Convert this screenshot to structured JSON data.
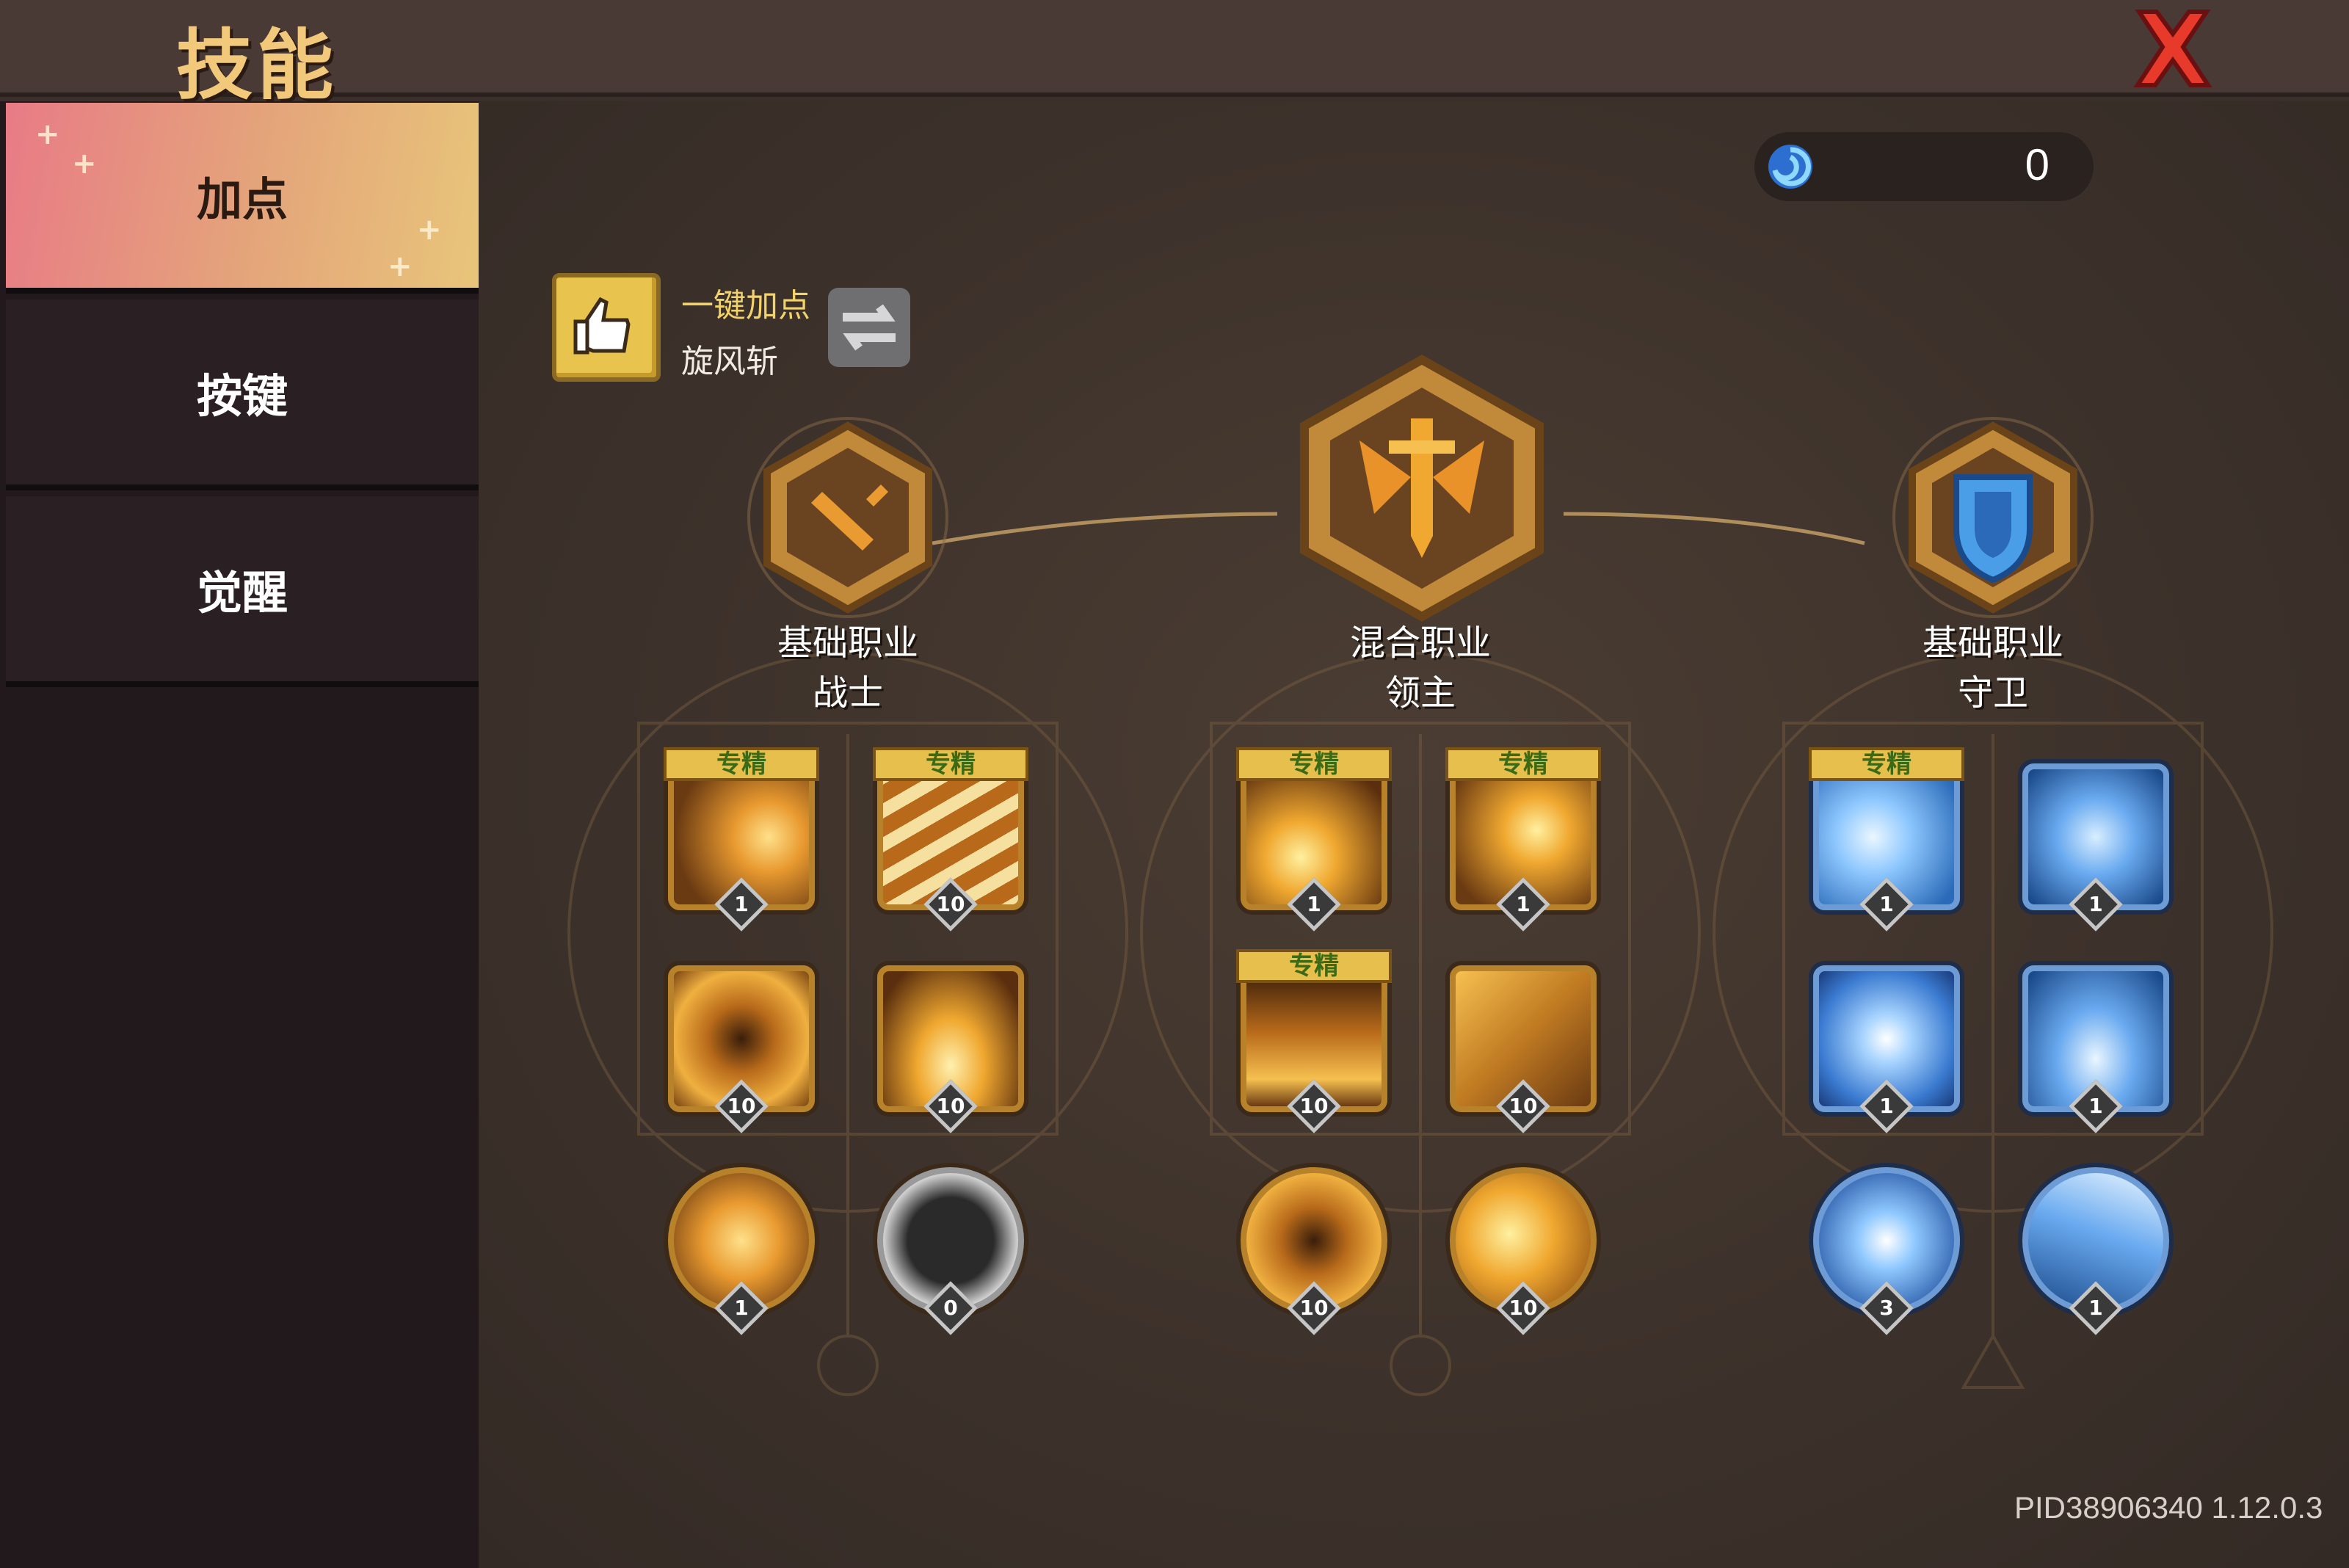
{
  "window": {
    "title": "技能"
  },
  "sidebar": {
    "tabs": [
      {
        "label": "加点",
        "active": true
      },
      {
        "label": "按键",
        "active": false
      },
      {
        "label": "觉醒",
        "active": false
      }
    ]
  },
  "currency": {
    "amount": "0",
    "icon": "swirl-orb-icon"
  },
  "auto_assign": {
    "label": "一键加点",
    "skill": "旋风斩",
    "icon": "thumbs-up-icon",
    "swap_icon": "swap-arrows-icon"
  },
  "jobs": [
    {
      "type": "基础职业",
      "name": "战士",
      "icon": "sword-icon",
      "theme": "gold"
    },
    {
      "type": "混合职业",
      "name": "领主",
      "icon": "winged-sword-icon",
      "theme": "gold"
    },
    {
      "type": "基础职业",
      "name": "守卫",
      "icon": "shield-icon",
      "theme": "blue"
    }
  ],
  "specialty_label": "专精",
  "skills": [
    {
      "col": 0,
      "levels": [
        "1",
        "10",
        "10",
        "10",
        "1",
        "0"
      ],
      "specialty": [
        true,
        true,
        false,
        false,
        false,
        false
      ]
    },
    {
      "col": 1,
      "levels": [
        "1",
        "1",
        "10",
        "10",
        "10",
        "10"
      ],
      "specialty": [
        true,
        true,
        true,
        false,
        false,
        false
      ]
    },
    {
      "col": 2,
      "levels": [
        "1",
        "1",
        "1",
        "1",
        "3",
        "1"
      ],
      "specialty": [
        true,
        false,
        false,
        false,
        false,
        false
      ]
    }
  ],
  "version": "PID38906340 1.12.0.3",
  "colors": {
    "accent_gold": "#e7bf4c",
    "close_red": "#e83a2a",
    "blue_theme": "#4a8fe0"
  }
}
